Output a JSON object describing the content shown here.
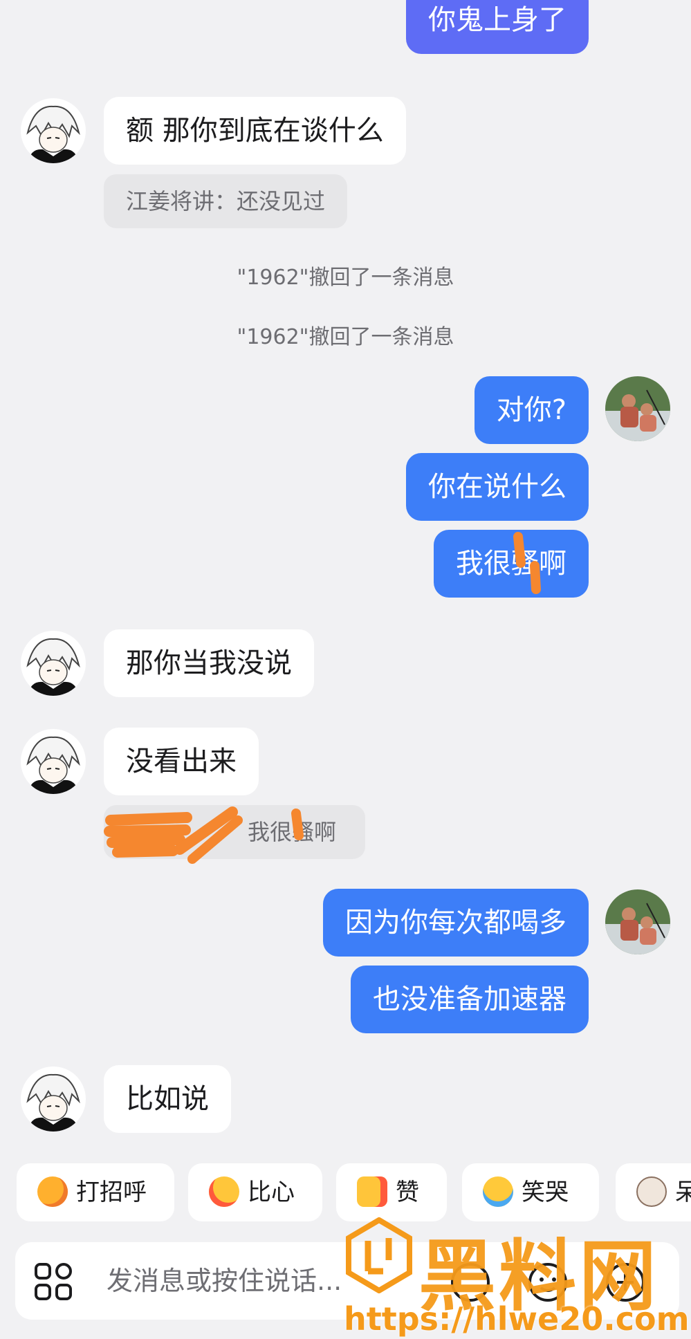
{
  "messages": {
    "m1": "你鬼上身了",
    "m2": "额 那你到底在谈什么",
    "q1": "江姜将讲：还没见过",
    "sys1": "\"1962\"撤回了一条消息",
    "sys2": "\"1962\"撤回了一条消息",
    "m3": "对你?",
    "m4": "你在说什么",
    "m5": "我很骚啊",
    "m6": "那你当我没说",
    "m7": "没看出来",
    "q2": "我很骚啊",
    "m8": "因为你每次都喝多",
    "m9": "也没准备加速器",
    "m10": "比如说"
  },
  "quick_replies": [
    {
      "label": "打招呼",
      "icon": "smile-wave-emoji-icon"
    },
    {
      "label": "比心",
      "icon": "heart-hands-emoji-icon"
    },
    {
      "label": "赞",
      "icon": "thumbs-up-emoji-icon"
    },
    {
      "label": "笑哭",
      "icon": "tears-of-joy-emoji-icon"
    },
    {
      "label": "呆",
      "icon": "cat-emoji-icon"
    }
  ],
  "input": {
    "placeholder": "发消息或按住说话..."
  },
  "watermark": {
    "brand": "黑料网",
    "url": "https://hlwe20.com"
  },
  "colors": {
    "outgoing_bubble": "#3d7ef8",
    "outgoing_bubble_alt": "#5e6cf5",
    "incoming_bubble": "#ffffff",
    "background": "#f1f1f3",
    "watermark": "#f59a1a"
  }
}
